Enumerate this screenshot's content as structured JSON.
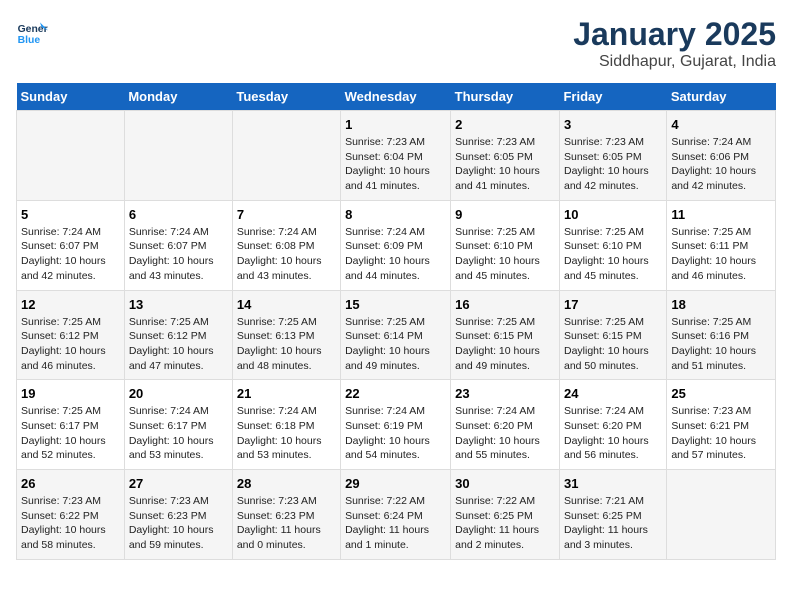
{
  "logo": {
    "text_general": "General",
    "text_blue": "Blue"
  },
  "title": "January 2025",
  "subtitle": "Siddhapur, Gujarat, India",
  "days_header": [
    "Sunday",
    "Monday",
    "Tuesday",
    "Wednesday",
    "Thursday",
    "Friday",
    "Saturday"
  ],
  "weeks": [
    [
      {
        "day": "",
        "info": ""
      },
      {
        "day": "",
        "info": ""
      },
      {
        "day": "",
        "info": ""
      },
      {
        "day": "1",
        "info": "Sunrise: 7:23 AM\nSunset: 6:04 PM\nDaylight: 10 hours\nand 41 minutes."
      },
      {
        "day": "2",
        "info": "Sunrise: 7:23 AM\nSunset: 6:05 PM\nDaylight: 10 hours\nand 41 minutes."
      },
      {
        "day": "3",
        "info": "Sunrise: 7:23 AM\nSunset: 6:05 PM\nDaylight: 10 hours\nand 42 minutes."
      },
      {
        "day": "4",
        "info": "Sunrise: 7:24 AM\nSunset: 6:06 PM\nDaylight: 10 hours\nand 42 minutes."
      }
    ],
    [
      {
        "day": "5",
        "info": "Sunrise: 7:24 AM\nSunset: 6:07 PM\nDaylight: 10 hours\nand 42 minutes."
      },
      {
        "day": "6",
        "info": "Sunrise: 7:24 AM\nSunset: 6:07 PM\nDaylight: 10 hours\nand 43 minutes."
      },
      {
        "day": "7",
        "info": "Sunrise: 7:24 AM\nSunset: 6:08 PM\nDaylight: 10 hours\nand 43 minutes."
      },
      {
        "day": "8",
        "info": "Sunrise: 7:24 AM\nSunset: 6:09 PM\nDaylight: 10 hours\nand 44 minutes."
      },
      {
        "day": "9",
        "info": "Sunrise: 7:25 AM\nSunset: 6:10 PM\nDaylight: 10 hours\nand 45 minutes."
      },
      {
        "day": "10",
        "info": "Sunrise: 7:25 AM\nSunset: 6:10 PM\nDaylight: 10 hours\nand 45 minutes."
      },
      {
        "day": "11",
        "info": "Sunrise: 7:25 AM\nSunset: 6:11 PM\nDaylight: 10 hours\nand 46 minutes."
      }
    ],
    [
      {
        "day": "12",
        "info": "Sunrise: 7:25 AM\nSunset: 6:12 PM\nDaylight: 10 hours\nand 46 minutes."
      },
      {
        "day": "13",
        "info": "Sunrise: 7:25 AM\nSunset: 6:12 PM\nDaylight: 10 hours\nand 47 minutes."
      },
      {
        "day": "14",
        "info": "Sunrise: 7:25 AM\nSunset: 6:13 PM\nDaylight: 10 hours\nand 48 minutes."
      },
      {
        "day": "15",
        "info": "Sunrise: 7:25 AM\nSunset: 6:14 PM\nDaylight: 10 hours\nand 49 minutes."
      },
      {
        "day": "16",
        "info": "Sunrise: 7:25 AM\nSunset: 6:15 PM\nDaylight: 10 hours\nand 49 minutes."
      },
      {
        "day": "17",
        "info": "Sunrise: 7:25 AM\nSunset: 6:15 PM\nDaylight: 10 hours\nand 50 minutes."
      },
      {
        "day": "18",
        "info": "Sunrise: 7:25 AM\nSunset: 6:16 PM\nDaylight: 10 hours\nand 51 minutes."
      }
    ],
    [
      {
        "day": "19",
        "info": "Sunrise: 7:25 AM\nSunset: 6:17 PM\nDaylight: 10 hours\nand 52 minutes."
      },
      {
        "day": "20",
        "info": "Sunrise: 7:24 AM\nSunset: 6:17 PM\nDaylight: 10 hours\nand 53 minutes."
      },
      {
        "day": "21",
        "info": "Sunrise: 7:24 AM\nSunset: 6:18 PM\nDaylight: 10 hours\nand 53 minutes."
      },
      {
        "day": "22",
        "info": "Sunrise: 7:24 AM\nSunset: 6:19 PM\nDaylight: 10 hours\nand 54 minutes."
      },
      {
        "day": "23",
        "info": "Sunrise: 7:24 AM\nSunset: 6:20 PM\nDaylight: 10 hours\nand 55 minutes."
      },
      {
        "day": "24",
        "info": "Sunrise: 7:24 AM\nSunset: 6:20 PM\nDaylight: 10 hours\nand 56 minutes."
      },
      {
        "day": "25",
        "info": "Sunrise: 7:23 AM\nSunset: 6:21 PM\nDaylight: 10 hours\nand 57 minutes."
      }
    ],
    [
      {
        "day": "26",
        "info": "Sunrise: 7:23 AM\nSunset: 6:22 PM\nDaylight: 10 hours\nand 58 minutes."
      },
      {
        "day": "27",
        "info": "Sunrise: 7:23 AM\nSunset: 6:23 PM\nDaylight: 10 hours\nand 59 minutes."
      },
      {
        "day": "28",
        "info": "Sunrise: 7:23 AM\nSunset: 6:23 PM\nDaylight: 11 hours\nand 0 minutes."
      },
      {
        "day": "29",
        "info": "Sunrise: 7:22 AM\nSunset: 6:24 PM\nDaylight: 11 hours\nand 1 minute."
      },
      {
        "day": "30",
        "info": "Sunrise: 7:22 AM\nSunset: 6:25 PM\nDaylight: 11 hours\nand 2 minutes."
      },
      {
        "day": "31",
        "info": "Sunrise: 7:21 AM\nSunset: 6:25 PM\nDaylight: 11 hours\nand 3 minutes."
      },
      {
        "day": "",
        "info": ""
      }
    ]
  ]
}
